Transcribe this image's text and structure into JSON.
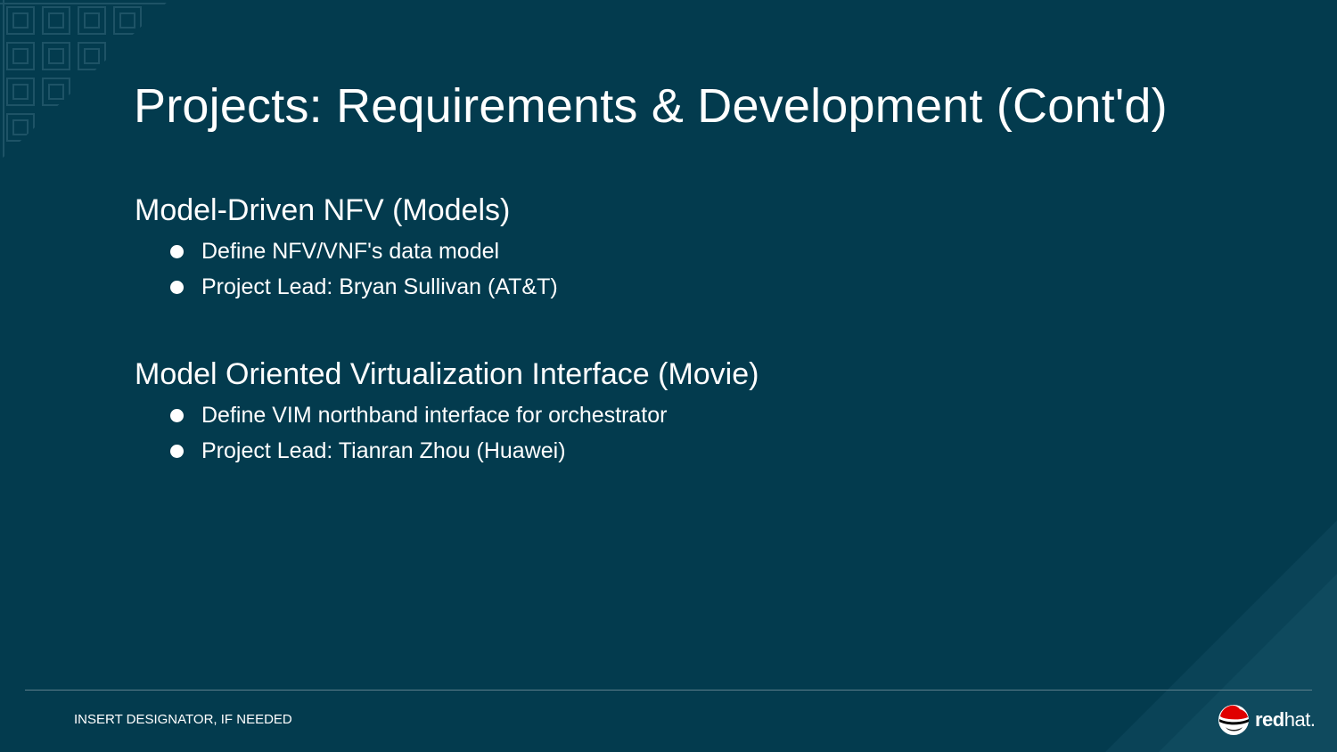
{
  "slide": {
    "title": "Projects: Requirements & Development (Cont'd)",
    "sections": [
      {
        "heading": "Model-Driven NFV (Models)",
        "bullets": [
          "Define NFV/VNF's data model",
          "Project Lead: Bryan Sullivan (AT&T)"
        ]
      },
      {
        "heading": "Model Oriented Virtualization Interface (Movie)",
        "bullets": [
          "Define VIM northband interface for orchestrator",
          "Project Lead: Tianran Zhou (Huawei)"
        ]
      }
    ]
  },
  "footer": {
    "designator": "INSERT DESIGNATOR, IF NEEDED",
    "logo_bold": "red",
    "logo_light": "hat."
  },
  "colors": {
    "background": "#033b4e",
    "accent_red": "#e00000"
  },
  "icons": {
    "logo": "redhat-shadowman-icon",
    "bullet": "bullet-dot-icon"
  }
}
